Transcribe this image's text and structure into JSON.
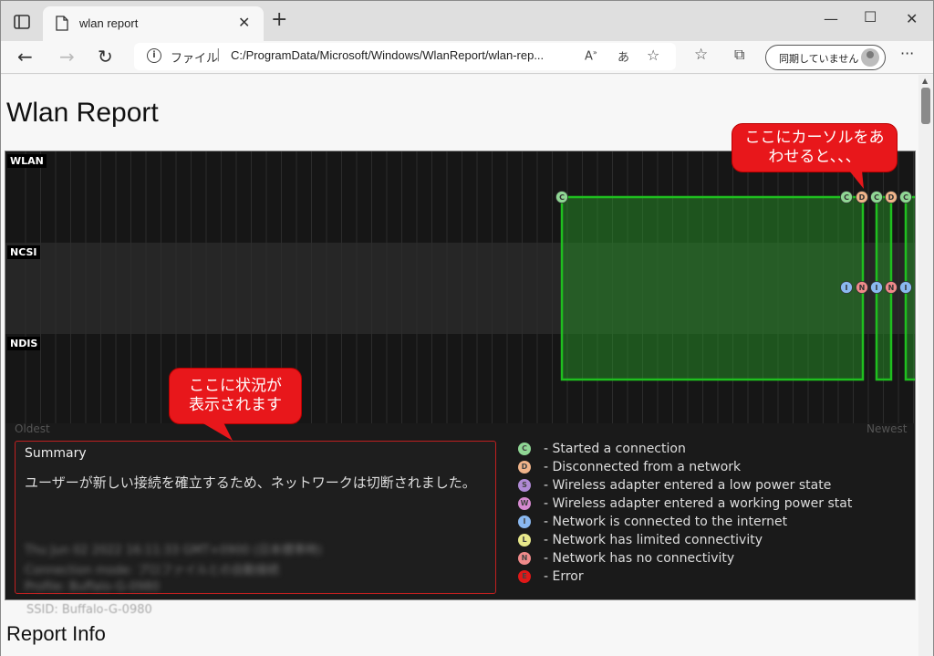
{
  "tab": {
    "title": "wlan report"
  },
  "address_bar": {
    "label": "ファイル",
    "url": "C:/ProgramData/Microsoft/Windows/WlanReport/wlan-rep..."
  },
  "sync_button": {
    "label": "同期していません"
  },
  "page": {
    "title": "Wlan Report",
    "section_title": "Report Info",
    "ssid_text": "SSID: Buffalo-G-0980"
  },
  "chart": {
    "lanes": [
      "WLAN",
      "NCSI",
      "NDIS"
    ],
    "axis_left": "Oldest",
    "axis_right": "Newest"
  },
  "summary": {
    "title": "Summary",
    "text": "ユーザーが新しい接続を確立するため、ネットワークは切断されました。",
    "blurred_lines": [
      "Thu Jun 02 2022 16:11:33 GMT+0900 (日本標準時)",
      "Connection mode: プロファイルとの自動接続",
      "Profile: Buffalo-G-0980"
    ]
  },
  "legend": [
    {
      "code": "C",
      "text": "- Started a connection",
      "color": "#8fd694"
    },
    {
      "code": "D",
      "text": "- Disconnected from a network",
      "color": "#f0b48a"
    },
    {
      "code": "S",
      "text": "- Wireless adapter entered a low power state",
      "color": "#b08ad6"
    },
    {
      "code": "W",
      "text": "- Wireless adapter entered a working power stat",
      "color": "#d68ad0"
    },
    {
      "code": "I",
      "text": "- Network is connected to the internet",
      "color": "#8ab8f0"
    },
    {
      "code": "L",
      "text": "- Network has limited connectivity",
      "color": "#e8e88a"
    },
    {
      "code": "N",
      "text": "- Network has no connectivity",
      "color": "#f08a8a"
    },
    {
      "code": "E",
      "text": "- Error",
      "color": "#e01818"
    }
  ],
  "callouts": {
    "top": "ここにカーソルをあわせると、、、",
    "top_line1": "ここにカーソルをあ",
    "top_line2": "わせると、、、",
    "bottom_line1": "ここに状況が",
    "bottom_line2": "表示されます"
  },
  "events": {
    "wlan": [
      "C",
      "C",
      "D",
      "C",
      "D",
      "C"
    ],
    "ncsi": [
      "I",
      "N",
      "I",
      "N",
      "I"
    ]
  }
}
